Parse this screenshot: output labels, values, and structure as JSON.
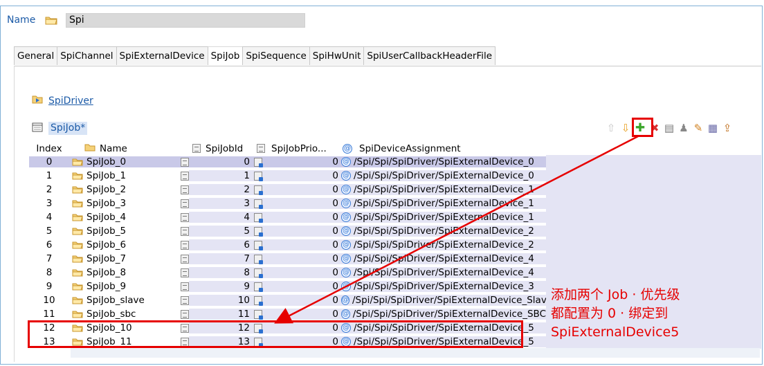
{
  "name_row": {
    "label": "Name",
    "value": "Spi"
  },
  "tabs": [
    "General",
    "SpiChannel",
    "SpiExternalDevice",
    "SpiJob",
    "SpiSequence",
    "SpiHwUnit",
    "SpiUserCallbackHeaderFile"
  ],
  "active_tab": "SpiJob",
  "driver_link": "SpiDriver",
  "list_title": "SpiJob*",
  "columns": {
    "index": "Index",
    "name": "Name",
    "job_id": "SpiJobId",
    "prio": "SpiJobPrio...",
    "device": "SpiDeviceAssignment"
  },
  "rows": [
    {
      "index": "0",
      "name": "SpiJob_0",
      "job_id": "0",
      "prio": "0",
      "device": "/Spi/Spi/SpiDriver/SpiExternalDevice_0"
    },
    {
      "index": "1",
      "name": "SpiJob_1",
      "job_id": "1",
      "prio": "0",
      "device": "/Spi/Spi/SpiDriver/SpiExternalDevice_0"
    },
    {
      "index": "2",
      "name": "SpiJob_2",
      "job_id": "2",
      "prio": "0",
      "device": "/Spi/Spi/SpiDriver/SpiExternalDevice_1"
    },
    {
      "index": "3",
      "name": "SpiJob_3",
      "job_id": "3",
      "prio": "0",
      "device": "/Spi/Spi/SpiDriver/SpiExternalDevice_1"
    },
    {
      "index": "4",
      "name": "SpiJob_4",
      "job_id": "4",
      "prio": "0",
      "device": "/Spi/Spi/SpiDriver/SpiExternalDevice_1"
    },
    {
      "index": "5",
      "name": "SpiJob_5",
      "job_id": "5",
      "prio": "0",
      "device": "/Spi/Spi/SpiDriver/SpiExternalDevice_2"
    },
    {
      "index": "6",
      "name": "SpiJob_6",
      "job_id": "6",
      "prio": "0",
      "device": "/Spi/Spi/SpiDriver/SpiExternalDevice_2"
    },
    {
      "index": "7",
      "name": "SpiJob_7",
      "job_id": "7",
      "prio": "0",
      "device": "/Spi/Spi/SpiDriver/SpiExternalDevice_4"
    },
    {
      "index": "8",
      "name": "SpiJob_8",
      "job_id": "8",
      "prio": "0",
      "device": "/Spi/Spi/SpiDriver/SpiExternalDevice_4"
    },
    {
      "index": "9",
      "name": "SpiJob_9",
      "job_id": "9",
      "prio": "0",
      "device": "/Spi/Spi/SpiDriver/SpiExternalDevice_3"
    },
    {
      "index": "10",
      "name": "SpiJob_slave",
      "job_id": "10",
      "prio": "0",
      "device": "/Spi/Spi/SpiDriver/SpiExternalDevice_Slave"
    },
    {
      "index": "11",
      "name": "SpiJob_sbc",
      "job_id": "11",
      "prio": "0",
      "device": "/Spi/Spi/SpiDriver/SpiExternalDevice_SBC"
    },
    {
      "index": "12",
      "name": "SpiJob_10",
      "job_id": "12",
      "prio": "0",
      "device": "/Spi/Spi/SpiDriver/SpiExternalDevice_5"
    },
    {
      "index": "13",
      "name": "SpiJob_11",
      "job_id": "13",
      "prio": "0",
      "device": "/Spi/Spi/SpiDriver/SpiExternalDevice_5"
    }
  ],
  "annotation": [
    "添加两个 Job · 优先级",
    "都配置为 0 · 绑定到",
    "SpiExternalDevice5"
  ],
  "colors": {
    "annotation": "#e60000",
    "link": "#1b5aa7",
    "row_bg": "#e4e4f4"
  }
}
